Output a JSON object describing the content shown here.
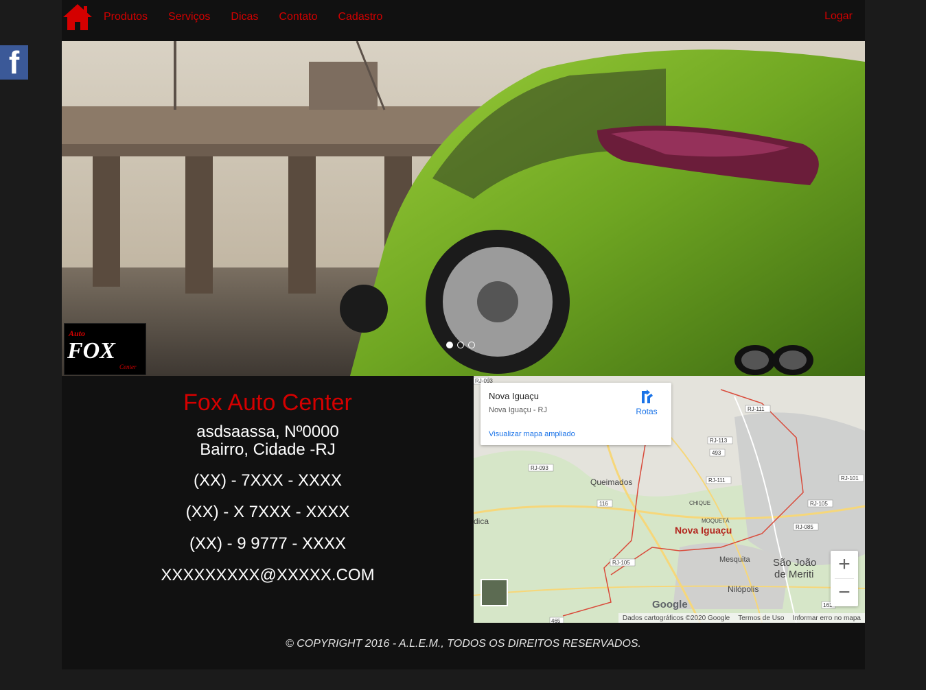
{
  "nav": {
    "items": [
      "Produtos",
      "Serviços",
      "Dicas",
      "Contato",
      "Cadastro"
    ],
    "login": "Logar",
    "accent_color": "#d40000"
  },
  "social": {
    "facebook_letter": "f",
    "facebook_color": "#3b5998"
  },
  "hero": {
    "slide_count": 3,
    "active_slide": 1,
    "logo_text_top": "Auto",
    "logo_text_main": "FOX",
    "logo_text_bottom": "Center"
  },
  "contact": {
    "company": "Fox Auto Center",
    "address_line1": "asdsaassa, Nº0000",
    "address_line2": "Bairro, Cidade -RJ",
    "phone1": "(XX) - 7XXX - XXXX",
    "phone2": "(XX) - X 7XXX - XXXX",
    "phone3": "(XX) - 9 9777 - XXXX",
    "email": "XXXXXXXXX@XXXXX.COM"
  },
  "map": {
    "place": "Nova Iguaçu",
    "place_sub": "Nova Iguaçu - RJ",
    "routes": "Rotas",
    "enlarge": "Visualizar mapa ampliado",
    "labels": {
      "queimados": "Queimados",
      "nova_iguacu": "Nova Iguaçu",
      "sao_joao": "São João",
      "de_meriti": "de Meriti",
      "mesquita": "Mesquita",
      "nilopolis": "Nilópolis",
      "chique": "CHIQUE",
      "moqueta": "MOQUETÁ",
      "dica": "dica"
    },
    "roads": [
      "RJ-093",
      "RJ-111",
      "RJ-113",
      "493",
      "RJ-093",
      "RJ-111",
      "RJ-101",
      "116",
      "RJ-105",
      "RJ-085",
      "RJ-105",
      "465",
      "161"
    ],
    "google": "Google",
    "attribution": "Dados cartográficos ©2020 Google",
    "terms": "Termos de Uso",
    "report": "Informar erro no mapa",
    "zoom_in": "+",
    "zoom_out": "−"
  },
  "footer": {
    "copyright": "© COPYRIGHT 2016 - A.L.E.M., TODOS OS DIREITOS RESERVADOS."
  }
}
